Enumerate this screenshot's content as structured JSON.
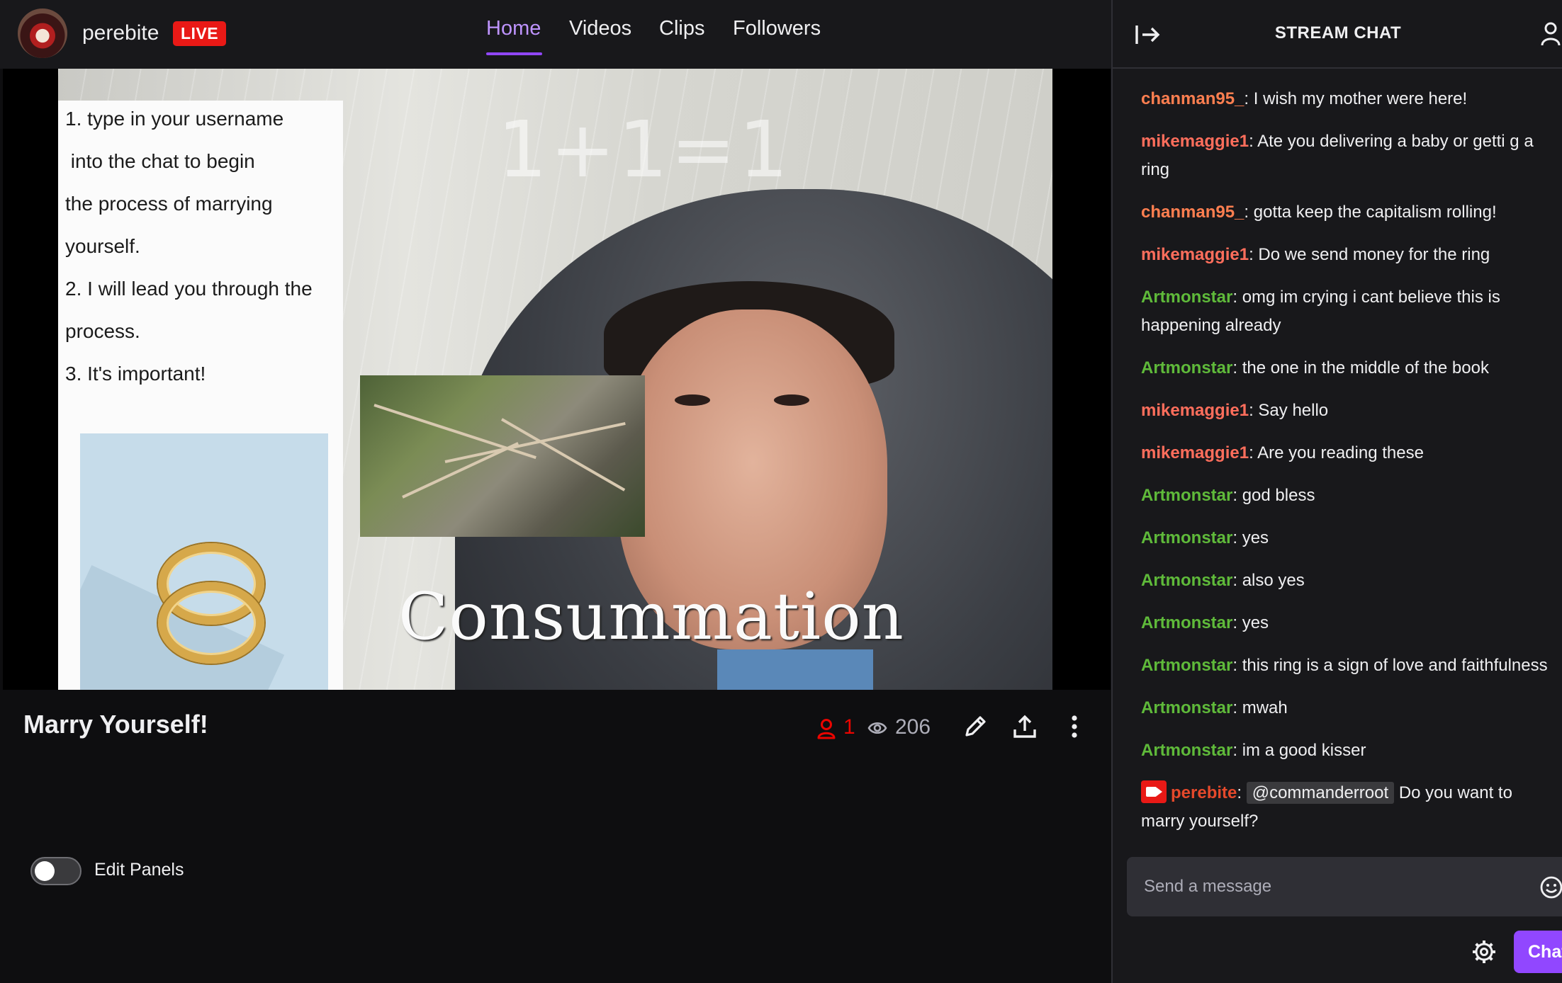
{
  "header": {
    "channel_name": "perebite",
    "live_label": "LIVE",
    "nav": [
      {
        "label": "Home",
        "active": true
      },
      {
        "label": "Videos",
        "active": false
      },
      {
        "label": "Clips",
        "active": false
      },
      {
        "label": "Followers",
        "active": false
      }
    ],
    "accent_color": "#9147ff",
    "live_color": "#e91916"
  },
  "video": {
    "instructions": [
      "1. type in your username",
      " into the chat to begin",
      "the process of marrying",
      "yourself.",
      "2. I will lead you through the",
      "process.",
      "3. It's important!"
    ],
    "wall_text": "1+1=1",
    "caption": "Consummation"
  },
  "stream_info": {
    "title": "Marry Yourself!",
    "viewer_count": "1",
    "total_views": "206",
    "icons": [
      "person-icon",
      "eye-icon",
      "pencil-icon",
      "share-icon",
      "kebab-menu-icon"
    ],
    "edit_panels_label": "Edit Panels",
    "edit_panels_on": false
  },
  "chat": {
    "title": "STREAM CHAT",
    "messages": [
      {
        "user": "chanman95_",
        "color": "#ff7f50",
        "text": "I wish my mother were here!"
      },
      {
        "user": "mikemaggie1",
        "color": "#ff6e5c",
        "text": "Ate you delivering a baby or getti g a ring"
      },
      {
        "user": "chanman95_",
        "color": "#ff7f50",
        "text": "gotta keep the capitalism rolling!"
      },
      {
        "user": "mikemaggie1",
        "color": "#ff6e5c",
        "text": "Do we send money for the ring"
      },
      {
        "user": "Artmonstar",
        "color": "#5fba3a",
        "text": "omg im crying i cant believe this is happening already"
      },
      {
        "user": "Artmonstar",
        "color": "#5fba3a",
        "text": "the one in the middle of the book"
      },
      {
        "user": "mikemaggie1",
        "color": "#ff6e5c",
        "text": "Say hello"
      },
      {
        "user": "mikemaggie1",
        "color": "#ff6e5c",
        "text": "Are you reading these"
      },
      {
        "user": "Artmonstar",
        "color": "#5fba3a",
        "text": "god bless"
      },
      {
        "user": "Artmonstar",
        "color": "#5fba3a",
        "text": "yes"
      },
      {
        "user": "Artmonstar",
        "color": "#5fba3a",
        "text": "also yes"
      },
      {
        "user": "Artmonstar",
        "color": "#5fba3a",
        "text": "yes"
      },
      {
        "user": "Artmonstar",
        "color": "#5fba3a",
        "text": "this ring is a sign of love and faithfulness"
      },
      {
        "user": "Artmonstar",
        "color": "#5fba3a",
        "text": "mwah"
      },
      {
        "user": "Artmonstar",
        "color": "#5fba3a",
        "text": "im a good kisser"
      }
    ],
    "broadcaster_message": {
      "user": "perebite",
      "color": "#e5492b",
      "mention": "@commanderroot",
      "text": "Do you want to marry yourself?"
    },
    "input_placeholder": "Send a message",
    "chat_button_label": "Chat"
  }
}
